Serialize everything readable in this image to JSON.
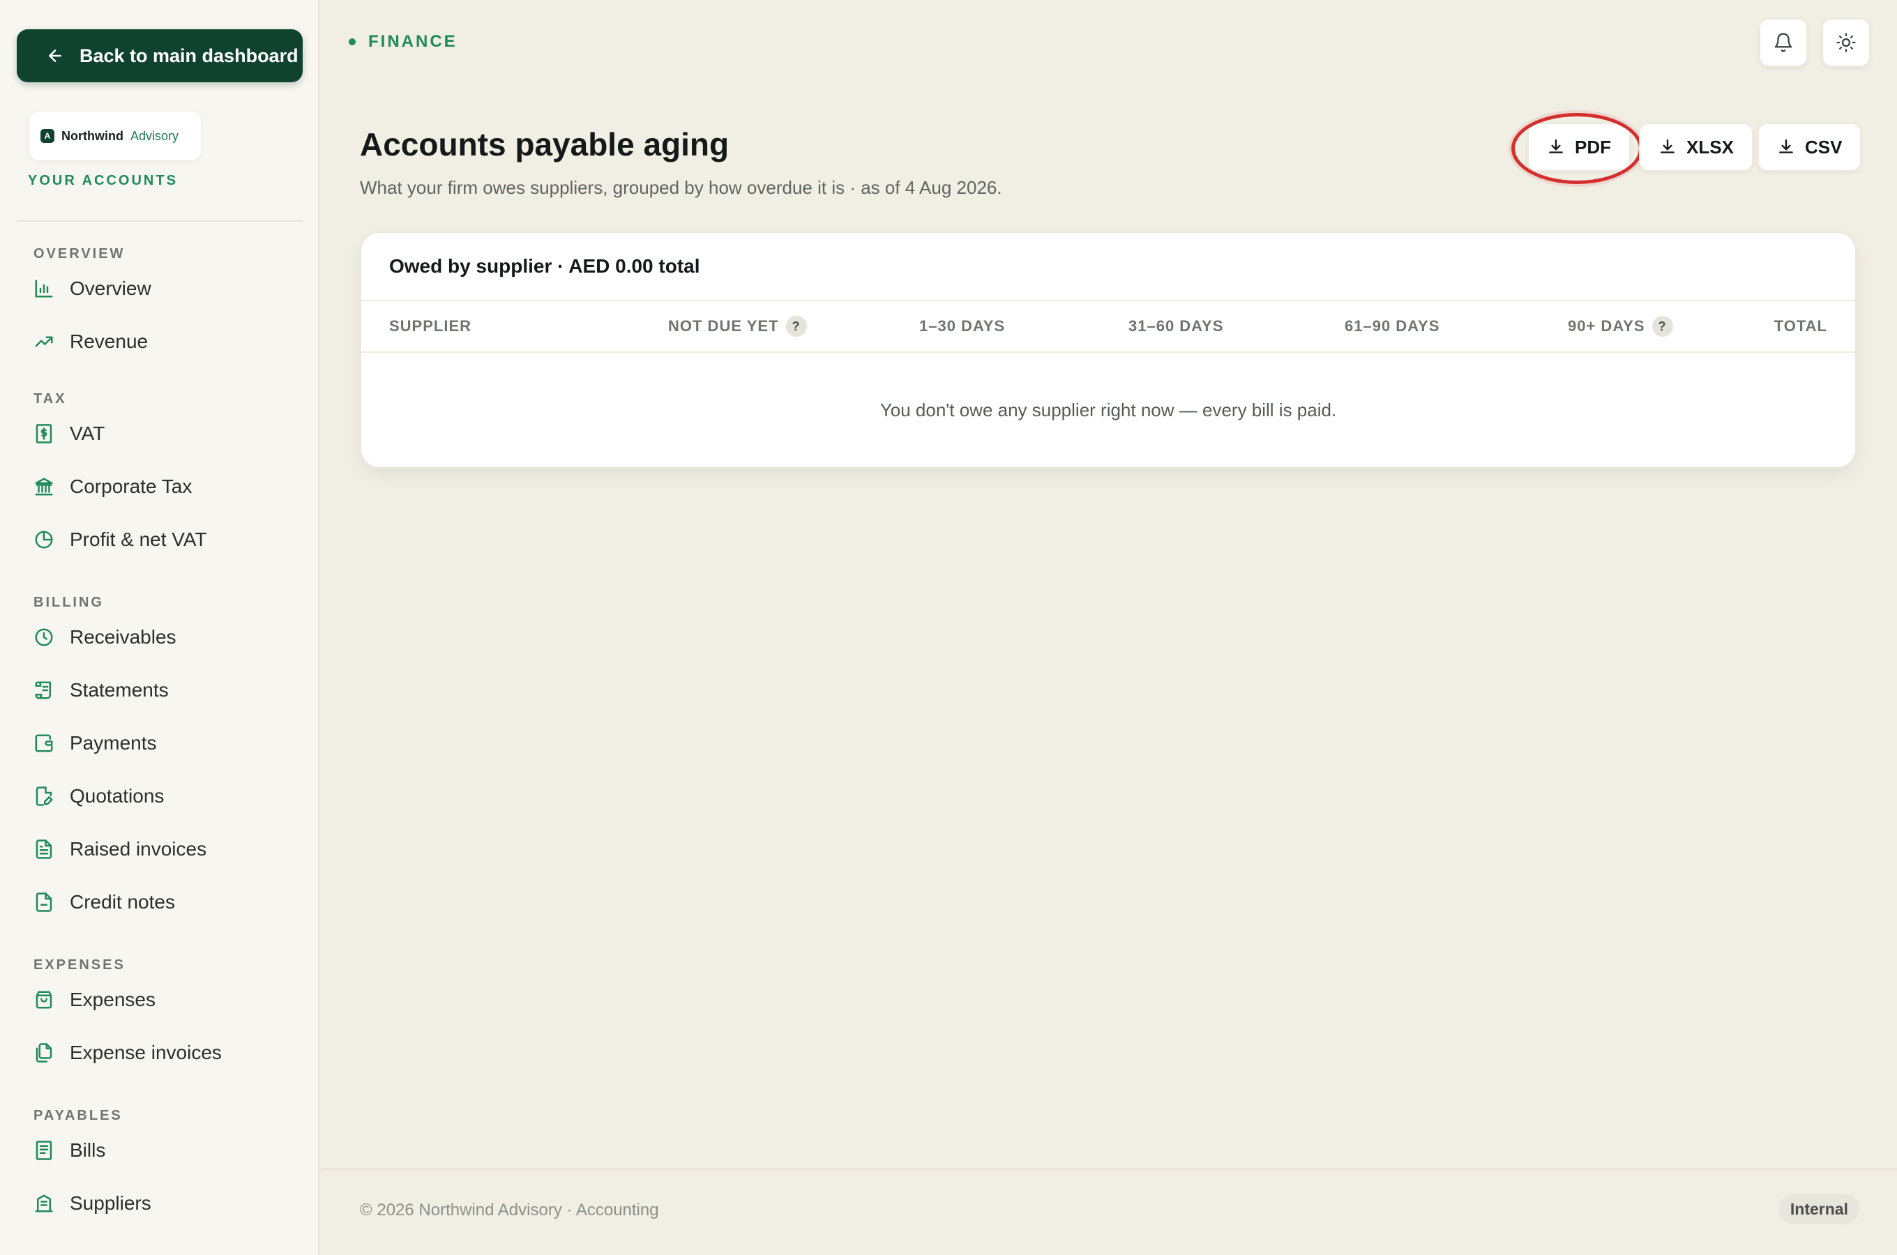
{
  "sidebar": {
    "back_label": "Back to main dashboard",
    "brand": {
      "name": "Northwind",
      "sub": "Advisory",
      "mark": "A"
    },
    "accounts_label": "YOUR ACCOUNTS",
    "sections": {
      "overview": "OVERVIEW",
      "tax": "TAX",
      "billing": "BILLING",
      "expenses": "EXPENSES",
      "payables": "PAYABLES"
    },
    "items": {
      "overview": "Overview",
      "revenue": "Revenue",
      "vat": "VAT",
      "corporate_tax": "Corporate Tax",
      "profit_net_vat": "Profit & net VAT",
      "receivables": "Receivables",
      "statements": "Statements",
      "payments": "Payments",
      "quotations": "Quotations",
      "raised_invoices": "Raised invoices",
      "credit_notes": "Credit notes",
      "expenses": "Expenses",
      "expense_invoices": "Expense invoices",
      "bills": "Bills",
      "suppliers": "Suppliers"
    }
  },
  "header": {
    "crumb": "FINANCE",
    "title": "Accounts payable aging",
    "subtitle": "What your firm owes suppliers, grouped by how overdue it is · as of 4 Aug 2026.",
    "exports": {
      "pdf": "PDF",
      "xlsx": "XLSX",
      "csv": "CSV"
    }
  },
  "card": {
    "title": "Owed by supplier · AED 0.00 total",
    "columns": {
      "supplier": "SUPPLIER",
      "not_due": "NOT DUE YET",
      "d1_30": "1–30 DAYS",
      "d31_60": "31–60 DAYS",
      "d61_90": "61–90 DAYS",
      "d90_plus": "90+ DAYS",
      "total": "TOTAL"
    },
    "help_glyph": "?",
    "empty_message": "You don't owe any supplier right now — every bill is paid."
  },
  "footer": {
    "text": "© 2026 Northwind Advisory · Accounting",
    "badge": "Internal"
  },
  "colors": {
    "accent": "#1f8a5b",
    "dark_green": "#10432f",
    "highlight": "#d42f2f"
  }
}
